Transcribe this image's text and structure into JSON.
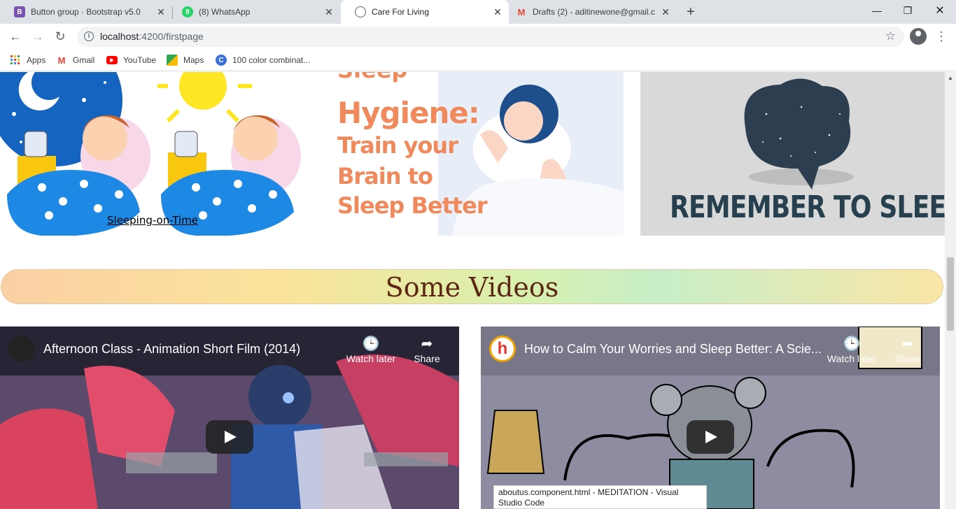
{
  "browser": {
    "tabs": [
      {
        "title": "Button group · Bootstrap v5.0",
        "favicon": "B"
      },
      {
        "title": "(8) WhatsApp",
        "favicon": "8"
      },
      {
        "title": "Care For Living",
        "favicon": "globe-icon"
      },
      {
        "title": "Drafts (2) - aditinewone@gmail.c",
        "favicon": "M"
      }
    ],
    "url_host": "localhost",
    "url_path": ":4200/firstpage",
    "bookmarks": [
      {
        "label": "Apps"
      },
      {
        "label": "Gmail"
      },
      {
        "label": "YouTube"
      },
      {
        "label": "Maps"
      },
      {
        "label": "100 color combinat..."
      }
    ]
  },
  "page": {
    "image1_link": "Sleeping-on-Time",
    "image2_lines": [
      "Sleep",
      "Hygiene:",
      "Train your",
      "Brain to",
      "Sleep Better"
    ],
    "image3_text": "REMEMBER TO SLEEP",
    "section_heading": "Some Videos",
    "videos": [
      {
        "title": "Afternoon Class - Animation Short Film (2014)",
        "watch_later": "Watch later",
        "share": "Share"
      },
      {
        "title": "How to Calm Your Worries and Sleep Better: A Scie...",
        "watch_later": "Watch later",
        "share": "Share"
      }
    ]
  },
  "status_text": "aboutus.component.html - MEDITATION - Visual Studio Code",
  "colors": {
    "heading": "#5c2612",
    "accent_orange": "#f08a5d",
    "sleep_text": "#27404f"
  }
}
